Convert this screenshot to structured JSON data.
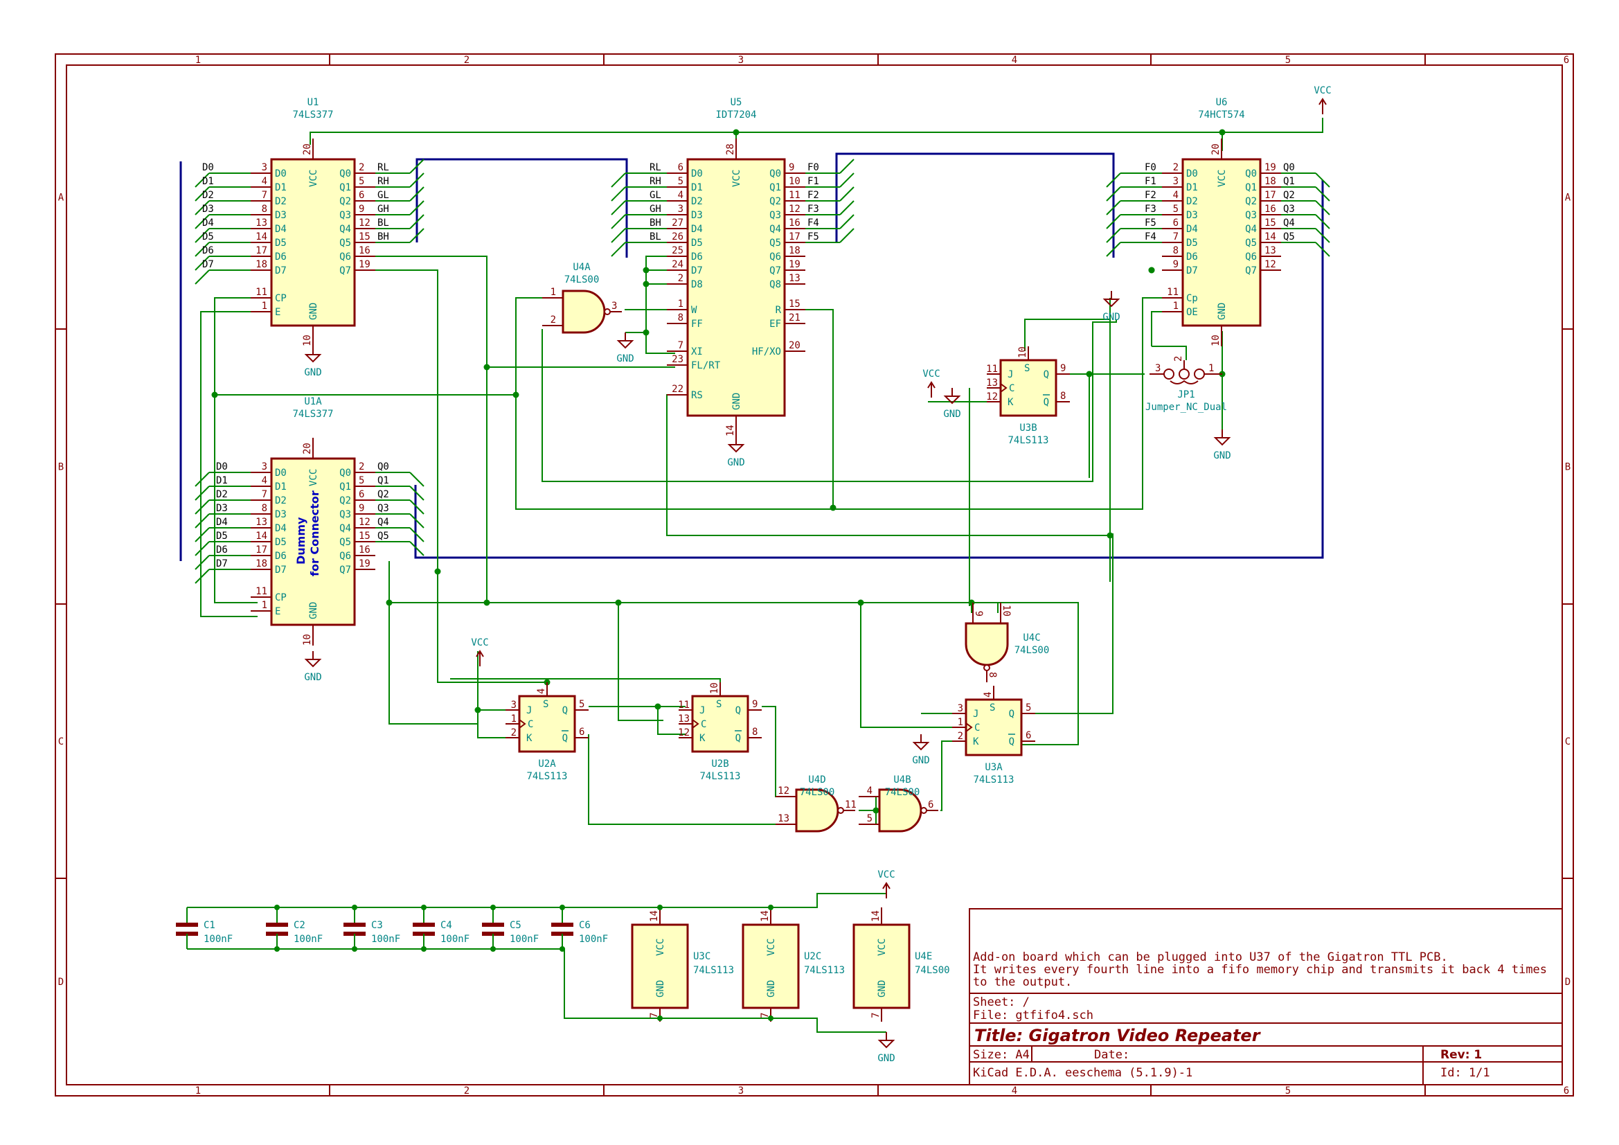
{
  "frame": {
    "col_labels": [
      "1",
      "2",
      "3",
      "4",
      "5",
      "6"
    ],
    "row_labels": [
      "A",
      "B",
      "C",
      "D"
    ]
  },
  "colors": {
    "wire": "#008400",
    "bus": "#000084",
    "component": "#840000",
    "component_fill": "#ffffc2",
    "label": "#008484"
  },
  "components": {
    "U1": {
      "ref": "U1",
      "value": "74LS377",
      "left_pins": [
        {
          "num": "3",
          "name": "D0",
          "net": "D0"
        },
        {
          "num": "4",
          "name": "D1",
          "net": "D1"
        },
        {
          "num": "7",
          "name": "D2",
          "net": "D2"
        },
        {
          "num": "8",
          "name": "D3",
          "net": "D3"
        },
        {
          "num": "13",
          "name": "D4",
          "net": "D4"
        },
        {
          "num": "14",
          "name": "D5",
          "net": "D5"
        },
        {
          "num": "17",
          "name": "D6",
          "net": "D6"
        },
        {
          "num": "18",
          "name": "D7",
          "net": "D7"
        },
        {
          "num": "11",
          "name": "CP",
          "net": ""
        },
        {
          "num": "1",
          "name": "E",
          "net": ""
        }
      ],
      "right_pins": [
        {
          "num": "2",
          "name": "Q0",
          "net": "RL"
        },
        {
          "num": "5",
          "name": "Q1",
          "net": "RH"
        },
        {
          "num": "6",
          "name": "Q2",
          "net": "GL"
        },
        {
          "num": "9",
          "name": "Q3",
          "net": "GH"
        },
        {
          "num": "12",
          "name": "Q4",
          "net": "BL"
        },
        {
          "num": "15",
          "name": "Q5",
          "net": "BH"
        },
        {
          "num": "16",
          "name": "Q6",
          "net": ""
        },
        {
          "num": "19",
          "name": "Q7",
          "net": ""
        }
      ],
      "vcc_pin": "20",
      "gnd_pin": "10",
      "vcc_name": "VCC",
      "gnd_name": "GND"
    },
    "U1A": {
      "ref": "U1A",
      "value": "74LS377",
      "note_line1": "Dummy",
      "note_line2": "for Connector",
      "left_pins": [
        {
          "num": "3",
          "name": "D0",
          "net": "D0"
        },
        {
          "num": "4",
          "name": "D1",
          "net": "D1"
        },
        {
          "num": "7",
          "name": "D2",
          "net": "D2"
        },
        {
          "num": "8",
          "name": "D3",
          "net": "D3"
        },
        {
          "num": "13",
          "name": "D4",
          "net": "D4"
        },
        {
          "num": "14",
          "name": "D5",
          "net": "D5"
        },
        {
          "num": "17",
          "name": "D6",
          "net": "D6"
        },
        {
          "num": "18",
          "name": "D7",
          "net": "D7"
        },
        {
          "num": "11",
          "name": "CP",
          "net": ""
        },
        {
          "num": "1",
          "name": "E",
          "net": ""
        }
      ],
      "right_pins": [
        {
          "num": "2",
          "name": "Q0",
          "net": "Q0"
        },
        {
          "num": "5",
          "name": "Q1",
          "net": "Q1"
        },
        {
          "num": "6",
          "name": "Q2",
          "net": "Q2"
        },
        {
          "num": "9",
          "name": "Q3",
          "net": "Q3"
        },
        {
          "num": "12",
          "name": "Q4",
          "net": "Q4"
        },
        {
          "num": "15",
          "name": "Q5",
          "net": "Q5"
        },
        {
          "num": "16",
          "name": "Q6",
          "net": ""
        },
        {
          "num": "19",
          "name": "Q7",
          "net": ""
        }
      ],
      "vcc_pin": "20",
      "gnd_pin": "10",
      "vcc_name": "VCC",
      "gnd_name": "GND"
    },
    "U5": {
      "ref": "U5",
      "value": "IDT7204",
      "left_pins": [
        {
          "num": "6",
          "name": "D0",
          "net": "RL"
        },
        {
          "num": "5",
          "name": "D1",
          "net": "RH"
        },
        {
          "num": "4",
          "name": "D2",
          "net": "GL"
        },
        {
          "num": "3",
          "name": "D3",
          "net": "GH"
        },
        {
          "num": "27",
          "name": "D4",
          "net": "BH"
        },
        {
          "num": "26",
          "name": "D5",
          "net": "BL"
        },
        {
          "num": "25",
          "name": "D6",
          "net": ""
        },
        {
          "num": "24",
          "name": "D7",
          "net": ""
        },
        {
          "num": "2",
          "name": "D8",
          "net": ""
        },
        {
          "num": "1",
          "name": "W",
          "net": ""
        },
        {
          "num": "8",
          "name": "FF",
          "net": ""
        },
        {
          "num": "7",
          "name": "XI",
          "net": ""
        },
        {
          "num": "23",
          "name": "FL/RT",
          "net": ""
        },
        {
          "num": "22",
          "name": "RS",
          "net": ""
        }
      ],
      "right_pins": [
        {
          "num": "9",
          "name": "Q0",
          "net": "F0"
        },
        {
          "num": "10",
          "name": "Q1",
          "net": "F1"
        },
        {
          "num": "11",
          "name": "Q2",
          "net": "F2"
        },
        {
          "num": "12",
          "name": "Q3",
          "net": "F3"
        },
        {
          "num": "16",
          "name": "Q4",
          "net": "F4"
        },
        {
          "num": "17",
          "name": "Q5",
          "net": "F5"
        },
        {
          "num": "18",
          "name": "Q6",
          "net": ""
        },
        {
          "num": "19",
          "name": "Q7",
          "net": ""
        },
        {
          "num": "13",
          "name": "Q8",
          "net": ""
        },
        {
          "num": "15",
          "name": "R",
          "net": ""
        },
        {
          "num": "21",
          "name": "EF",
          "net": ""
        },
        {
          "num": "20",
          "name": "HF/XO",
          "net": ""
        }
      ],
      "vcc_pin": "28",
      "gnd_pin": "14",
      "vcc_name": "VCC",
      "gnd_name": "GND"
    },
    "U6": {
      "ref": "U6",
      "value": "74HCT574",
      "left_pins": [
        {
          "num": "2",
          "name": "D0",
          "net": "F0"
        },
        {
          "num": "3",
          "name": "D1",
          "net": "F1"
        },
        {
          "num": "4",
          "name": "D2",
          "net": "F2"
        },
        {
          "num": "5",
          "name": "D3",
          "net": "F3"
        },
        {
          "num": "6",
          "name": "D4",
          "net": "F5"
        },
        {
          "num": "7",
          "name": "D5",
          "net": "F4"
        },
        {
          "num": "8",
          "name": "D6",
          "net": ""
        },
        {
          "num": "9",
          "name": "D7",
          "net": ""
        },
        {
          "num": "11",
          "name": "Cp",
          "net": ""
        },
        {
          "num": "1",
          "name": "OE",
          "net": ""
        }
      ],
      "right_pins": [
        {
          "num": "19",
          "name": "Q0",
          "net": "Q0"
        },
        {
          "num": "18",
          "name": "Q1",
          "net": "Q1"
        },
        {
          "num": "17",
          "name": "Q2",
          "net": "Q2"
        },
        {
          "num": "16",
          "name": "Q3",
          "net": "Q3"
        },
        {
          "num": "15",
          "name": "Q4",
          "net": "Q4"
        },
        {
          "num": "14",
          "name": "Q5",
          "net": "Q5"
        },
        {
          "num": "13",
          "name": "Q6",
          "net": ""
        },
        {
          "num": "12",
          "name": "Q7",
          "net": ""
        }
      ],
      "vcc_pin": "20",
      "gnd_pin": "10",
      "vcc_name": "VCC",
      "gnd_name": "GND"
    },
    "U4A": {
      "ref": "U4A",
      "value": "74LS00",
      "in_pins": [
        "1",
        "2"
      ],
      "out_pin": "3"
    },
    "U4C": {
      "ref": "U4C",
      "value": "74LS00",
      "in_pins": [
        "10",
        "9"
      ],
      "out_pin": "8"
    },
    "U4D": {
      "ref": "U4D",
      "value": "74LS00",
      "in_pins": [
        "12",
        "13"
      ],
      "out_pin": "11"
    },
    "U4B": {
      "ref": "U4B",
      "value": "74LS00",
      "in_pins": [
        "4",
        "5"
      ],
      "out_pin": "6"
    },
    "U3B": {
      "ref": "U3B",
      "value": "74LS113",
      "pins": {
        "J": "11",
        "C": "13",
        "K": "12",
        "S": "10",
        "Q": "9",
        "Qn": "8"
      }
    },
    "U3A": {
      "ref": "U3A",
      "value": "74LS113",
      "pins": {
        "J": "3",
        "C": "1",
        "K": "2",
        "S": "4",
        "Q": "5",
        "Qn": "6"
      }
    },
    "U2A": {
      "ref": "U2A",
      "value": "74LS113",
      "pins": {
        "J": "3",
        "C": "1",
        "K": "2",
        "S": "4",
        "Q": "5",
        "Qn": "6"
      }
    },
    "U2B": {
      "ref": "U2B",
      "value": "74LS113",
      "pins": {
        "J": "11",
        "C": "13",
        "K": "12",
        "S": "10",
        "Q": "9",
        "Qn": "8"
      }
    },
    "JP1": {
      "ref": "JP1",
      "value": "Jumper_NC_Dual",
      "pins": [
        "3",
        "2",
        "1"
      ]
    },
    "power_units": [
      {
        "ref": "U3C",
        "value": "74LS113",
        "vcc_pin": "14",
        "gnd_pin": "7"
      },
      {
        "ref": "U2C",
        "value": "74LS113",
        "vcc_pin": "14",
        "gnd_pin": "7"
      },
      {
        "ref": "U4E",
        "value": "74LS00",
        "vcc_pin": "14",
        "gnd_pin": "7"
      }
    ],
    "capacitors": [
      {
        "ref": "C1",
        "value": "100nF"
      },
      {
        "ref": "C2",
        "value": "100nF"
      },
      {
        "ref": "C3",
        "value": "100nF"
      },
      {
        "ref": "C4",
        "value": "100nF"
      },
      {
        "ref": "C5",
        "value": "100nF"
      },
      {
        "ref": "C6",
        "value": "100nF"
      }
    ]
  },
  "power": {
    "vcc": "VCC",
    "gnd": "GND",
    "pin1": "1"
  },
  "pin_labels": {
    "J": "J",
    "C": "C",
    "K": "K",
    "S": "S",
    "Q": "Q",
    "Qn": "Q"
  },
  "title_block": {
    "comment_lines": [
      "Add-on board which can be plugged into U37 of the Gigatron TTL PCB.",
      "It writes every fourth line into a fifo memory chip and transmits it back 4 times",
      "to the output."
    ],
    "sheet": "Sheet: /",
    "file": "File: gtfifo4.sch",
    "title": "Title: Gigatron Video Repeater",
    "size": "Size: A4",
    "date": "Date:",
    "rev": "Rev: 1",
    "tool": "KiCad E.D.A.  eeschema (5.1.9)-1",
    "id": "Id: 1/1"
  }
}
